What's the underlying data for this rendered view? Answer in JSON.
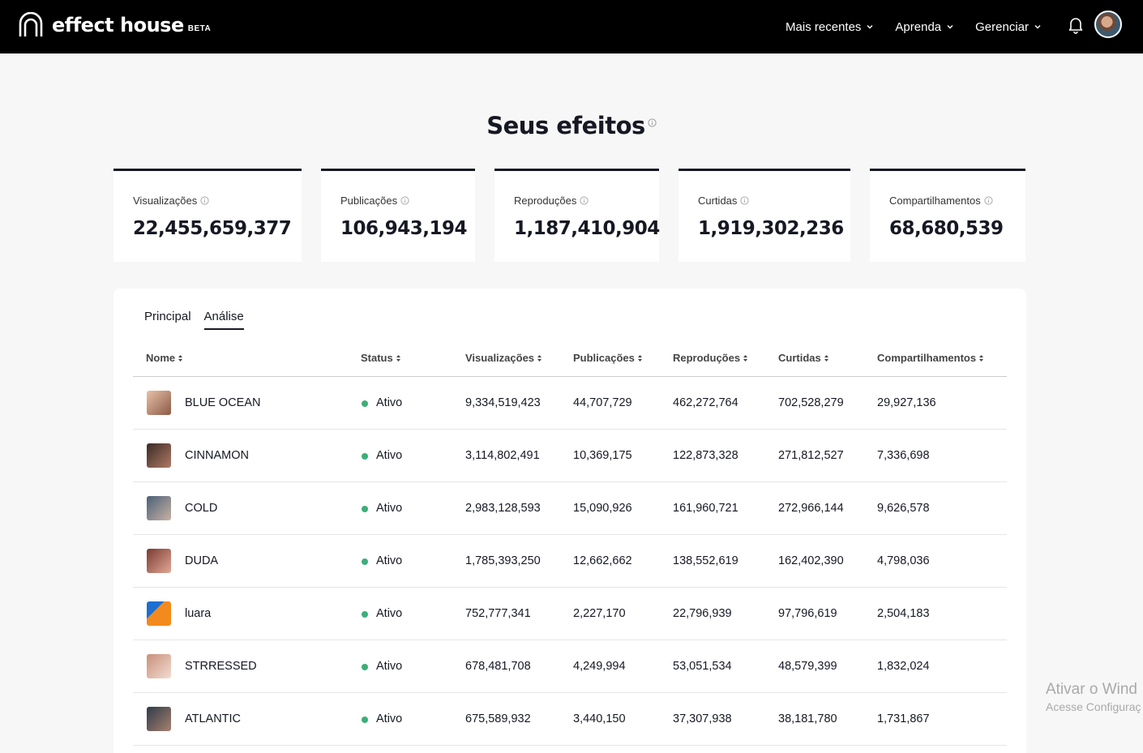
{
  "header": {
    "logo_text": "effect house",
    "logo_badge": "BETA",
    "nav": [
      {
        "label": "Mais recentes"
      },
      {
        "label": "Aprenda"
      },
      {
        "label": "Gerenciar"
      }
    ]
  },
  "page_title": "Seus efeitos",
  "stats": [
    {
      "label": "Visualizações",
      "value": "22,455,659,377"
    },
    {
      "label": "Publicações",
      "value": "106,943,194"
    },
    {
      "label": "Reproduções",
      "value": "1,187,410,904"
    },
    {
      "label": "Curtidas",
      "value": "1,919,302,236"
    },
    {
      "label": "Compartilhamentos",
      "value": "68,680,539"
    }
  ],
  "tabs": [
    {
      "label": "Principal"
    },
    {
      "label": "Análise"
    }
  ],
  "active_tab": "Análise",
  "table": {
    "columns": [
      "Nome",
      "Status",
      "Visualizações",
      "Publicações",
      "Reproduções",
      "Curtidas",
      "Compartilhamentos"
    ],
    "rows": [
      {
        "name": "BLUE OCEAN",
        "status": "Ativo",
        "views": "9,334,519,423",
        "posts": "44,707,729",
        "plays": "462,272,764",
        "likes": "702,528,279",
        "shares": "29,927,136"
      },
      {
        "name": "CINNAMON",
        "status": "Ativo",
        "views": "3,114,802,491",
        "posts": "10,369,175",
        "plays": "122,873,328",
        "likes": "271,812,527",
        "shares": "7,336,698"
      },
      {
        "name": "COLD",
        "status": "Ativo",
        "views": "2,983,128,593",
        "posts": "15,090,926",
        "plays": "161,960,721",
        "likes": "272,966,144",
        "shares": "9,626,578"
      },
      {
        "name": "DUDA",
        "status": "Ativo",
        "views": "1,785,393,250",
        "posts": "12,662,662",
        "plays": "138,552,619",
        "likes": "162,402,390",
        "shares": "4,798,036"
      },
      {
        "name": "luara",
        "status": "Ativo",
        "views": "752,777,341",
        "posts": "2,227,170",
        "plays": "22,796,939",
        "likes": "97,796,619",
        "shares": "2,504,183"
      },
      {
        "name": "STRRESSED",
        "status": "Ativo",
        "views": "678,481,708",
        "posts": "4,249,994",
        "plays": "53,051,534",
        "likes": "48,579,399",
        "shares": "1,832,024"
      },
      {
        "name": "ATLANTIC",
        "status": "Ativo",
        "views": "675,589,932",
        "posts": "3,440,150",
        "plays": "37,307,938",
        "likes": "38,181,780",
        "shares": "1,731,867"
      }
    ]
  },
  "watermark": {
    "line1": "Ativar o Wind",
    "line2": "Acesse Configuraç"
  },
  "colors": {
    "topbar": "#000000",
    "status_active": "#3cae7a",
    "text": "#161823"
  },
  "icons": [
    "logo-arch-icon",
    "chevron-down-icon",
    "bell-icon",
    "info-icon",
    "sort-icon"
  ]
}
